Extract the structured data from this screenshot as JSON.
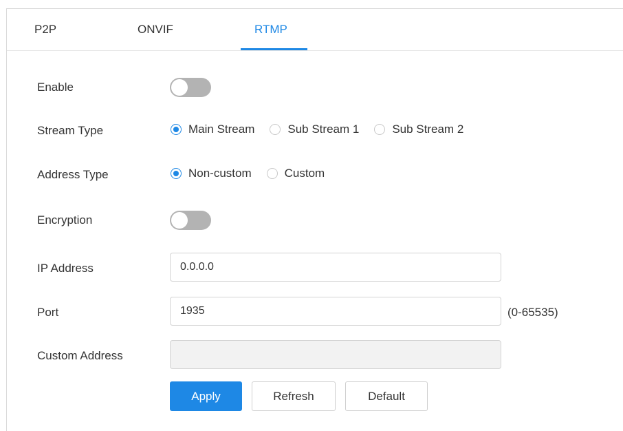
{
  "tabs": [
    {
      "label": "P2P"
    },
    {
      "label": "ONVIF"
    },
    {
      "label": "RTMP",
      "active": true
    }
  ],
  "form": {
    "enable": {
      "label": "Enable",
      "on": false
    },
    "stream_type": {
      "label": "Stream Type",
      "options": [
        "Main Stream",
        "Sub Stream 1",
        "Sub Stream 2"
      ],
      "selected": "Main Stream"
    },
    "address_type": {
      "label": "Address Type",
      "options": [
        "Non-custom",
        "Custom"
      ],
      "selected": "Non-custom"
    },
    "encryption": {
      "label": "Encryption",
      "on": false
    },
    "ip_address": {
      "label": "IP Address",
      "value": "0.0.0.0"
    },
    "port": {
      "label": "Port",
      "value": "1935",
      "range": "(0-65535)"
    },
    "custom_address": {
      "label": "Custom Address",
      "value": "",
      "disabled": true
    }
  },
  "buttons": {
    "apply": "Apply",
    "refresh": "Refresh",
    "default": "Default"
  },
  "colors": {
    "accent": "#1e88e5",
    "toggle_off": "#b3b3b3"
  }
}
